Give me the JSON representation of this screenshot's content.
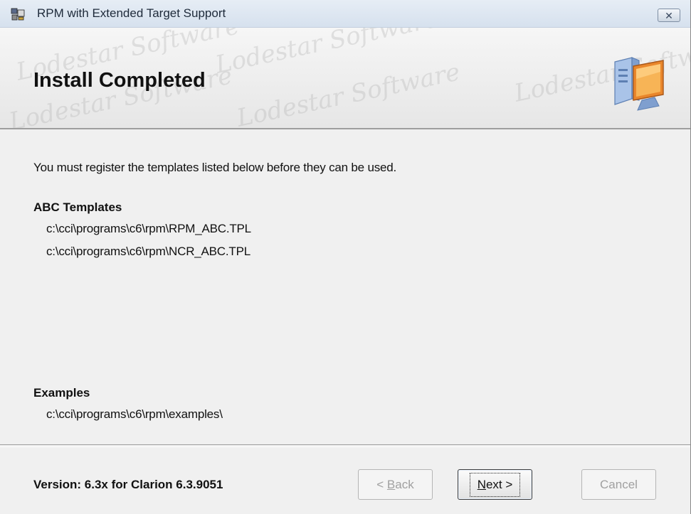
{
  "window": {
    "title": "RPM with Extended Target Support",
    "close_glyph": "✕"
  },
  "banner": {
    "title": "Install Completed",
    "watermark_text": "Lodestar Software",
    "icon": "computer-icon"
  },
  "content": {
    "instruction": "You must register the templates listed below before they can be used.",
    "abc_templates": {
      "heading": "ABC Templates",
      "paths": [
        "c:\\cci\\programs\\c6\\rpm\\RPM_ABC.TPL",
        "c:\\cci\\programs\\c6\\rpm\\NCR_ABC.TPL"
      ]
    },
    "examples": {
      "heading": "Examples",
      "paths": [
        "c:\\cci\\programs\\c6\\rpm\\examples\\"
      ]
    }
  },
  "footer": {
    "version": "Version: 6.3x for Clarion 6.3.9051",
    "back_button": {
      "label_before": "< ",
      "mnemonic": "B",
      "label_after": "ack"
    },
    "next_button": {
      "label_before": "",
      "mnemonic": "N",
      "label_after": "ext >"
    },
    "cancel_button": "Cancel"
  },
  "colors": {
    "dialog_bg": "#f0f0f0",
    "titlebar_top": "#e6edf5",
    "titlebar_bottom": "#d6e1ee",
    "disabled_text": "#a0a0a0"
  }
}
